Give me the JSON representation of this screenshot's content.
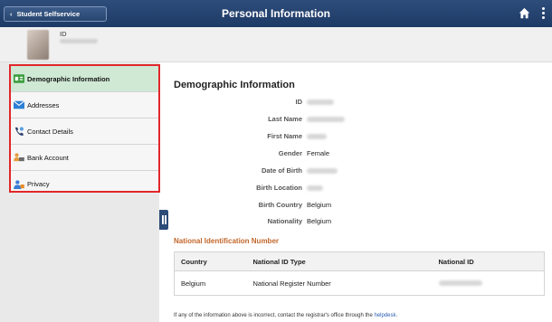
{
  "header": {
    "back_label": "Student Selfservice",
    "title": "Personal Information",
    "icons": [
      "chevron-left-icon",
      "home-icon",
      "kebab-menu-icon"
    ],
    "colors": {
      "bar": "#1d3a66",
      "highlight": "#e1262a",
      "active_nav": "#cfe9d4",
      "accent_orange": "#c2662a"
    }
  },
  "profile": {
    "id_label": "ID"
  },
  "sidebar": {
    "items": [
      {
        "label": "Demographic Information",
        "icon": "id-card-icon",
        "active": true
      },
      {
        "label": "Addresses",
        "icon": "envelope-icon",
        "active": false
      },
      {
        "label": "Contact Details",
        "icon": "phone-icon",
        "active": false
      },
      {
        "label": "Bank Account",
        "icon": "bank-account-icon",
        "active": false
      },
      {
        "label": "Privacy",
        "icon": "privacy-person-icon",
        "active": false
      }
    ]
  },
  "main": {
    "section_title": "Demographic Information",
    "fields": [
      {
        "label": "ID",
        "value": ""
      },
      {
        "label": "Last Name",
        "value": ""
      },
      {
        "label": "First Name",
        "value": ""
      },
      {
        "label": "Gender",
        "value": "Female"
      },
      {
        "label": "Date of Birth",
        "value": ""
      },
      {
        "label": "Birth Location",
        "value": ""
      },
      {
        "label": "Birth Country",
        "value": "Belgium"
      },
      {
        "label": "Nationality",
        "value": "Belgium"
      }
    ],
    "nin": {
      "title": "National Identification Number",
      "columns": [
        "Country",
        "National ID Type",
        "National ID"
      ],
      "rows": [
        {
          "country": "Belgium",
          "type": "National Register Number",
          "id": ""
        }
      ]
    },
    "footnote": {
      "text": "If any of the information above is incorrect, contact the registrar's office through the",
      "link": "helpdesk",
      "end": "."
    }
  }
}
